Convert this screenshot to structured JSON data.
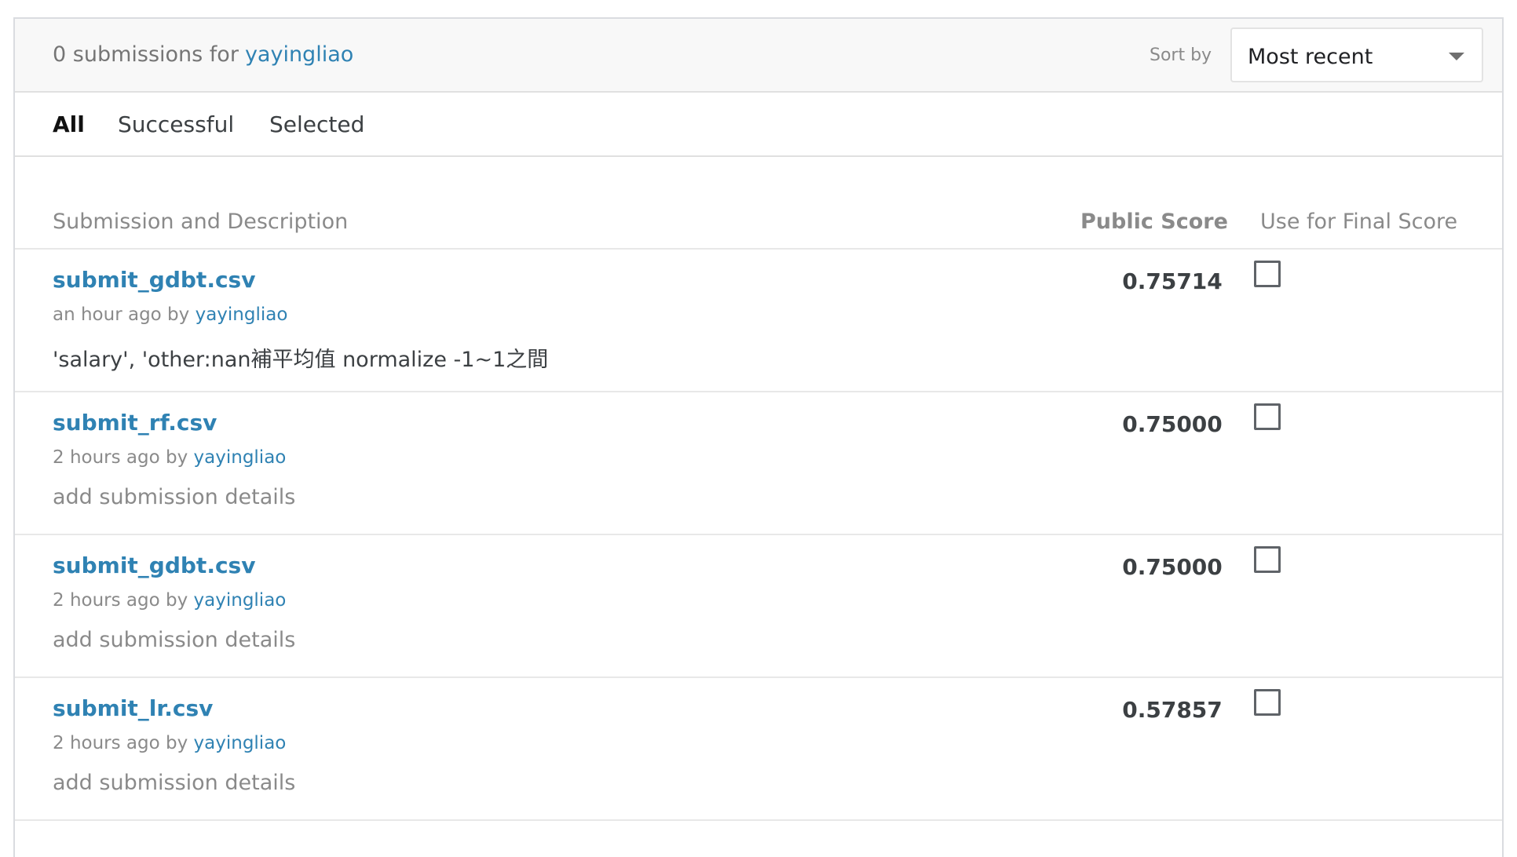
{
  "header": {
    "count_text": "0 submissions for",
    "user": "yayingliao",
    "sort_label": "Sort by",
    "sort_value": "Most recent"
  },
  "tabs": [
    {
      "label": "All",
      "active": true
    },
    {
      "label": "Successful",
      "active": false
    },
    {
      "label": "Selected",
      "active": false
    }
  ],
  "columns": {
    "submission": "Submission and Description",
    "public_score": "Public Score",
    "final_score": "Use for Final Score"
  },
  "rows": [
    {
      "file": "submit_gdbt.csv",
      "time": "an hour ago by",
      "user": "yayingliao",
      "description": "'salary', 'other:nan補平均值 normalize -1~1之間",
      "score": "0.75714",
      "selected": false
    },
    {
      "file": "submit_rf.csv",
      "time": "2 hours ago by",
      "user": "yayingliao",
      "description": "add submission details",
      "score": "0.75000",
      "selected": false
    },
    {
      "file": "submit_gdbt.csv",
      "time": "2 hours ago by",
      "user": "yayingliao",
      "description": "add submission details",
      "score": "0.75000",
      "selected": false
    },
    {
      "file": "submit_lr.csv",
      "time": "2 hours ago by",
      "user": "yayingliao",
      "description": "add submission details",
      "score": "0.57857",
      "selected": false
    }
  ]
}
